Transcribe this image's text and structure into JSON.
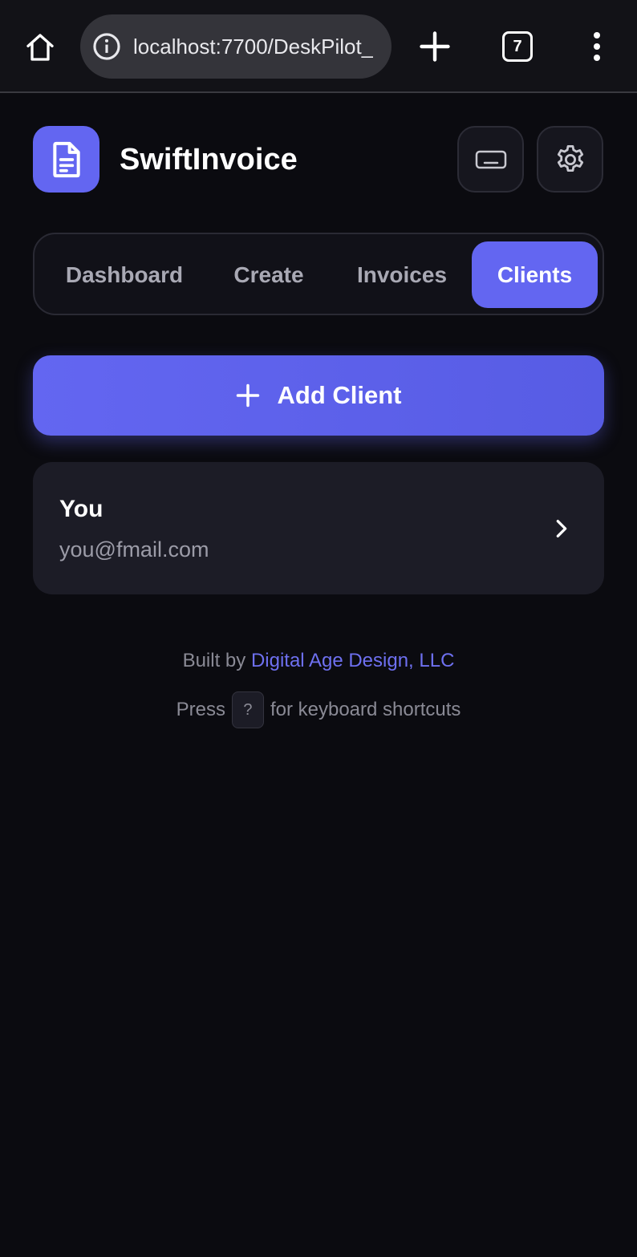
{
  "browser": {
    "url": "localhost:7700/DeskPilot_",
    "tab_count": "7"
  },
  "app": {
    "title": "SwiftInvoice"
  },
  "nav": {
    "tabs": [
      {
        "label": "Dashboard",
        "active": false
      },
      {
        "label": "Create",
        "active": false
      },
      {
        "label": "Invoices",
        "active": false
      },
      {
        "label": "Clients",
        "active": true
      }
    ]
  },
  "actions": {
    "add_client_label": "Add Client"
  },
  "clients": [
    {
      "name": "You",
      "email": "you@fmail.com"
    }
  ],
  "footer": {
    "built_by_prefix": "Built by",
    "built_by_link": "Digital Age Design, LLC",
    "press_prefix": "Press",
    "shortcut_key": "?",
    "press_suffix": "for keyboard shortcuts"
  },
  "colors": {
    "accent": "#6366f1",
    "background": "#0b0b10",
    "card": "#1c1c26",
    "link": "#6e70f0"
  },
  "icons": {
    "home": "home-icon",
    "info": "info-icon",
    "new_tab": "plus-icon",
    "menu": "more-vertical-icon",
    "logo": "document-icon",
    "keyboard": "keyboard-icon",
    "settings": "gear-icon",
    "add": "plus-icon",
    "chevron": "chevron-right-icon"
  }
}
